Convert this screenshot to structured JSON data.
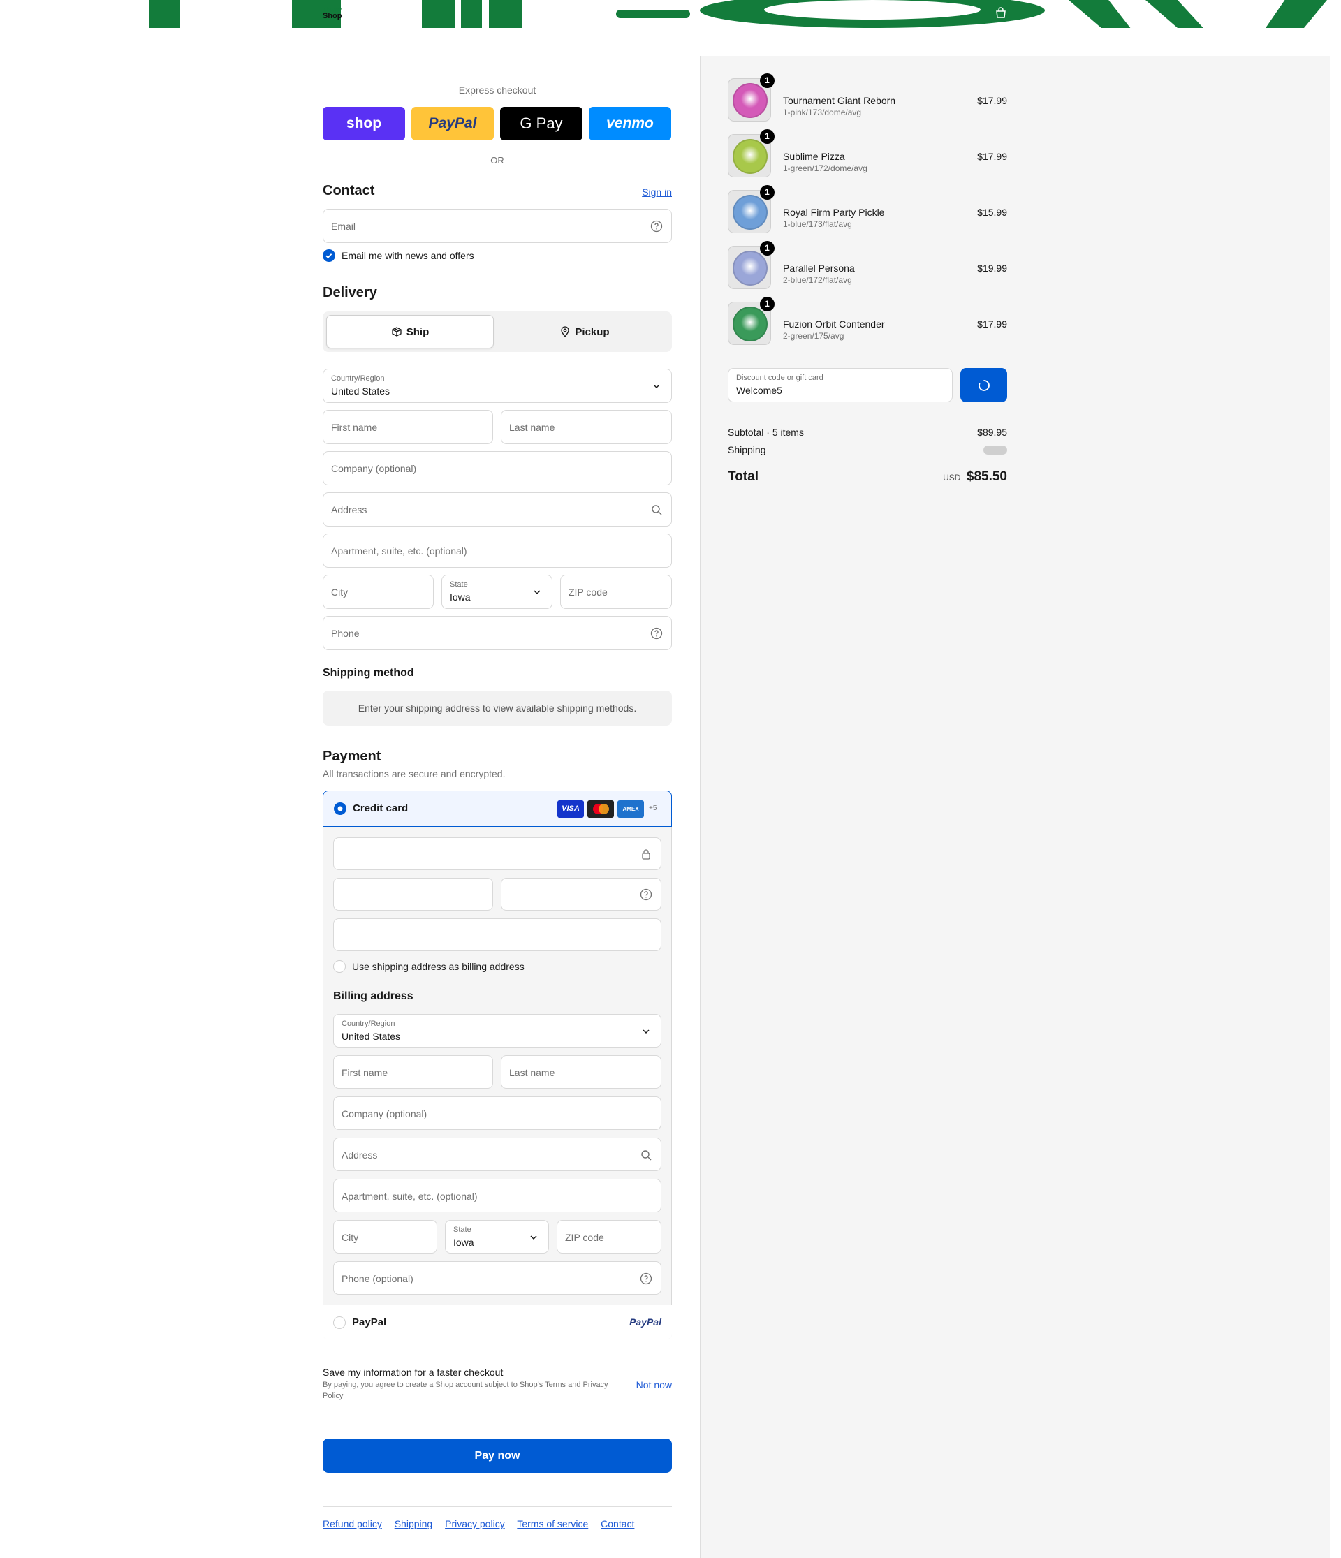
{
  "header": {
    "brand_lines": [
      "Throw",
      "Shop"
    ]
  },
  "express": {
    "title": "Express checkout",
    "buttons": [
      "shop",
      "PayPal",
      "G Pay",
      "venmo"
    ],
    "or_label": "OR"
  },
  "contact": {
    "title": "Contact",
    "sign_in": "Sign in",
    "email_placeholder": "Email",
    "news_label": "Email me with news and offers"
  },
  "delivery": {
    "title": "Delivery",
    "ship_label": "Ship",
    "pickup_label": "Pickup",
    "country_label": "Country/Region",
    "country_value": "United States",
    "first_name": "First name",
    "last_name": "Last name",
    "company": "Company (optional)",
    "address": "Address",
    "apartment": "Apartment, suite, etc. (optional)",
    "city": "City",
    "state_label": "State",
    "state_value": "Iowa",
    "zip": "ZIP code",
    "phone": "Phone"
  },
  "shipping_method": {
    "title": "Shipping method",
    "message": "Enter your shipping address to view available shipping methods."
  },
  "payment": {
    "title": "Payment",
    "subtitle": "All transactions are secure and encrypted.",
    "credit_card_label": "Credit card",
    "card_brands": [
      "VISA",
      "Mastercard",
      "AMEX"
    ],
    "more_brands": "+5",
    "use_shipping_label": "Use shipping address as billing address",
    "paypal_label": "PayPal",
    "paypal_logo": "PayPal"
  },
  "billing": {
    "title": "Billing address",
    "country_label": "Country/Region",
    "country_value": "United States",
    "first_name": "First name",
    "last_name": "Last name",
    "company": "Company (optional)",
    "address": "Address",
    "apartment": "Apartment, suite, etc. (optional)",
    "city": "City",
    "state_label": "State",
    "state_value": "Iowa",
    "zip": "ZIP code",
    "phone": "Phone (optional)"
  },
  "save_info": {
    "title": "Save my information for a faster checkout",
    "legal_prefix": "By paying, you agree to create a Shop account subject to Shop's",
    "terms": "Terms",
    "and": "and",
    "privacy": "Privacy Policy",
    "not_now": "Not now"
  },
  "pay_now": "Pay now",
  "footer": {
    "links": [
      "Refund policy",
      "Shipping",
      "Privacy policy",
      "Terms of service",
      "Contact"
    ]
  },
  "summary": {
    "items": [
      {
        "name": "Tournament Giant Reborn",
        "variant": "1-pink/173/dome/avg",
        "price": "$17.99",
        "qty": "1",
        "color": "#d45ab8"
      },
      {
        "name": "Sublime Pizza",
        "variant": "1-green/172/dome/avg",
        "price": "$17.99",
        "qty": "1",
        "color": "#a8c84a"
      },
      {
        "name": "Royal Firm Party Pickle",
        "variant": "1-blue/173/flat/avg",
        "price": "$15.99",
        "qty": "1",
        "color": "#6f9fd8"
      },
      {
        "name": "Parallel Persona",
        "variant": "2-blue/172/flat/avg",
        "price": "$19.99",
        "qty": "1",
        "color": "#9aa6d8"
      },
      {
        "name": "Fuzion Orbit Contender",
        "variant": "2-green/175/avg",
        "price": "$17.99",
        "qty": "1",
        "color": "#3a9a5a"
      }
    ],
    "discount_label": "Discount code or gift card",
    "discount_value": "Welcome5",
    "subtotal_label": "Subtotal · 5 items",
    "subtotal_value": "$89.95",
    "shipping_label": "Shipping",
    "total_label": "Total",
    "currency": "USD",
    "total_value": "$85.50"
  },
  "colors": {
    "brand_green": "#137c3b",
    "accent_blue": "#005bd3",
    "shop_purple": "#5a31f4",
    "paypal_yellow": "#ffc439",
    "venmo_blue": "#008cff"
  }
}
